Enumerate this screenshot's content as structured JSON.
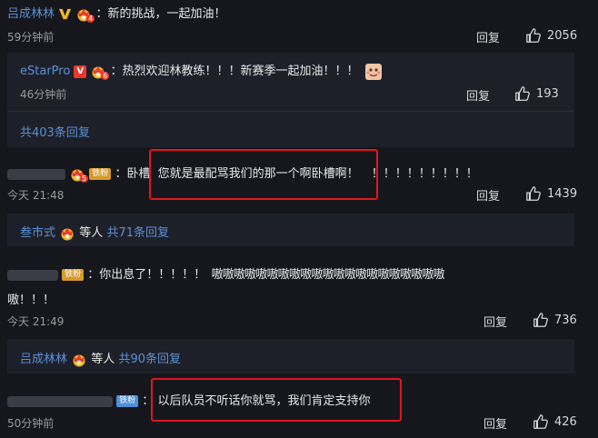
{
  "comments": [
    {
      "user": "吕成林林",
      "level": "4",
      "text": "：新的挑战，一起加油！",
      "time": "59分钟前",
      "reply": "回复",
      "likes": "2056",
      "sub": {
        "user": "eStarPro",
        "level": "6",
        "text": "：热烈欢迎林教练！！！新赛季一起加油！！！",
        "time": "46分钟前",
        "reply": "回复",
        "likes": "193",
        "more": "共403条回复"
      }
    },
    {
      "user": "",
      "level": "5",
      "fan": "铁粉",
      "text_a": "：卧槽",
      "text_b": "您就是最配骂我们的那一个啊卧槽啊！",
      "text_c": "！！！！！！！！！",
      "time": "今天 21:48",
      "reply": "回复",
      "likes": "1439",
      "sub_summary": {
        "user": "叁市式",
        "etc": "等人",
        "more": "共71条回复"
      }
    },
    {
      "user": "",
      "fan": "铁粉",
      "text_a": "：你出息了！！！！！",
      "text_b": "嗷嗷嗷嗷嗷嗷嗷嗷嗷嗷嗷嗷嗷嗷嗷嗷嗷嗷嗷嗷嗷",
      "text_c": "嗷！！！",
      "time": "今天 21:49",
      "reply": "回复",
      "likes": "736",
      "sub_summary": {
        "user": "吕成林林",
        "etc": "等人",
        "more": "共90条回复"
      }
    },
    {
      "user": "",
      "fan": "铁粉",
      "text_a": "：",
      "text_b": "以后队员不听话你就骂，我们肯定支持你",
      "time": "50分钟前",
      "reply": "回复",
      "likes": "426"
    }
  ],
  "colors": {
    "background": "#16171d",
    "link": "#5b8fd6",
    "highlight_box": "#e0161e",
    "fan_badge": "#d79b2a"
  }
}
